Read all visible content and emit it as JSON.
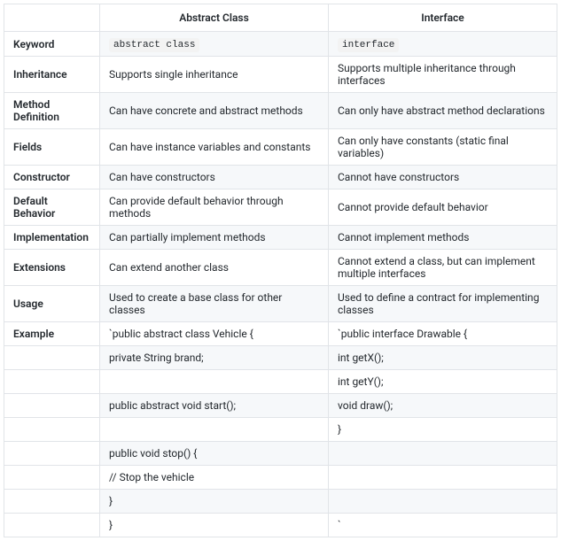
{
  "headers": {
    "blank": "",
    "col1": "Abstract Class",
    "col2": "Interface"
  },
  "rows": [
    {
      "label": "Keyword",
      "col1_code": "abstract class",
      "col2_code": "interface"
    },
    {
      "label": "Inheritance",
      "col1": "Supports single inheritance",
      "col2": "Supports multiple inheritance through interfaces"
    },
    {
      "label": "Method Definition",
      "col1": "Can have concrete and abstract methods",
      "col2": "Can only have abstract method declarations"
    },
    {
      "label": "Fields",
      "col1": "Can have instance variables and constants",
      "col2": "Can only have constants (static final variables)"
    },
    {
      "label": "Constructor",
      "col1": "Can have constructors",
      "col2": "Cannot have constructors"
    },
    {
      "label": "Default Behavior",
      "col1": "Can provide default behavior through methods",
      "col2": "Cannot provide default behavior"
    },
    {
      "label": "Implementation",
      "col1": "Can partially implement methods",
      "col2": "Cannot implement methods"
    },
    {
      "label": "Extensions",
      "col1": "Can extend another class",
      "col2": "Cannot extend a class, but can implement multiple interfaces"
    },
    {
      "label": "Usage",
      "col1": "Used to create a base class for other classes",
      "col2": "Used to define a contract for implementing classes"
    },
    {
      "label": "Example",
      "col1": "`public abstract class Vehicle {",
      "col2": "`public interface Drawable {"
    },
    {
      "label": "",
      "col1": "private String brand;",
      "col2": "int getX();"
    },
    {
      "label": "",
      "col1": "",
      "col2": "int getY();"
    },
    {
      "label": "",
      "col1": "public abstract void start();",
      "col2": "void draw();"
    },
    {
      "label": "",
      "col1": "",
      "col2": "}"
    },
    {
      "label": "",
      "col1": "public void stop() {",
      "col2": ""
    },
    {
      "label": "",
      "col1": "// Stop the vehicle",
      "col2": ""
    },
    {
      "label": "",
      "col1": "}",
      "col2": ""
    },
    {
      "label": "",
      "col1": "}",
      "col2": "`"
    }
  ]
}
